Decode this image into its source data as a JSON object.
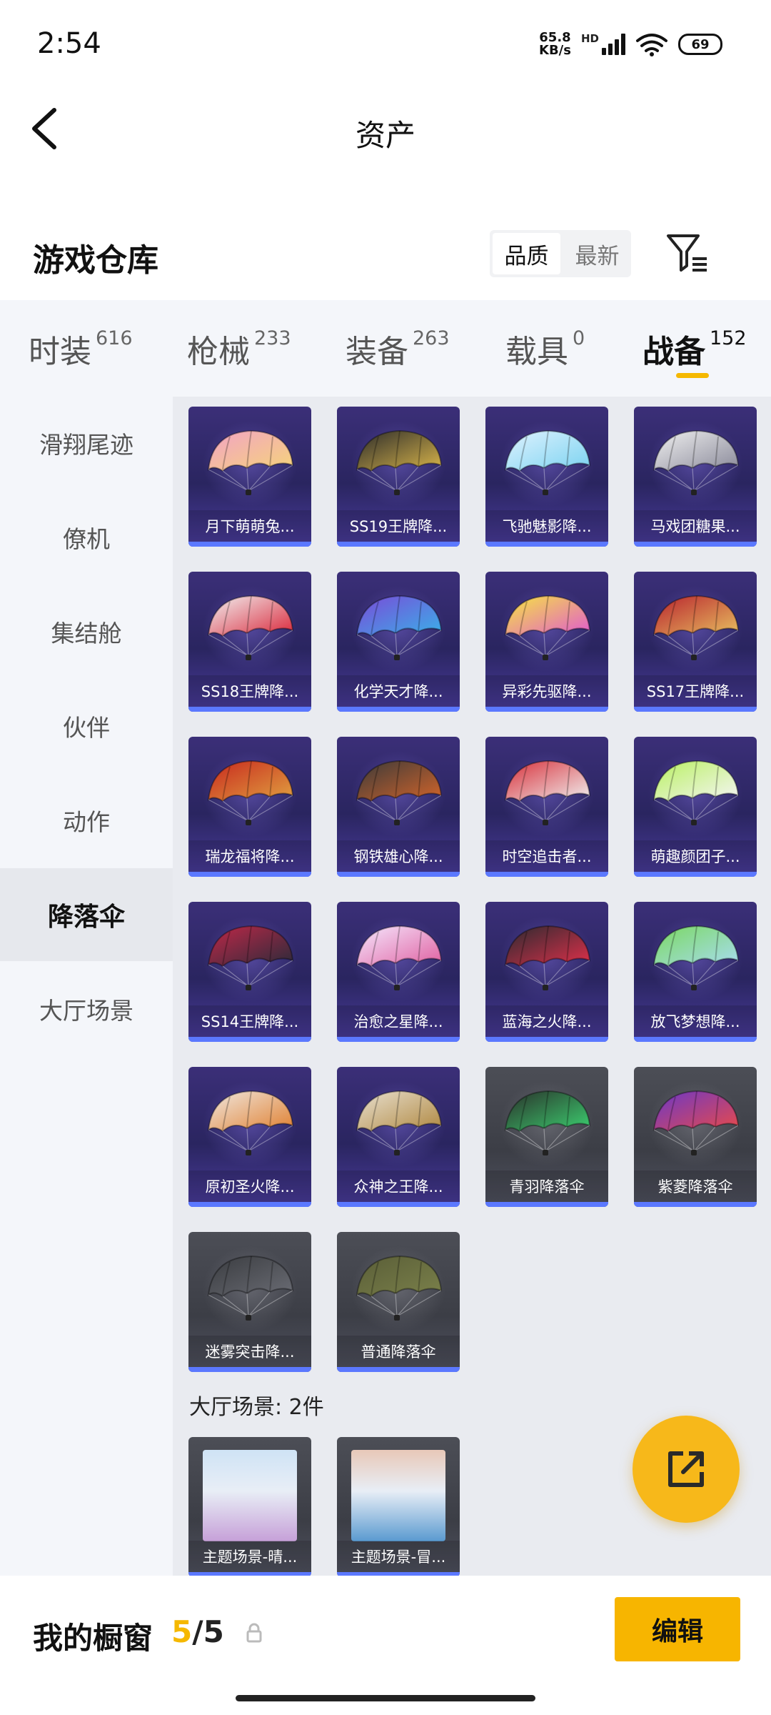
{
  "status": {
    "time": "2:54",
    "net_speed_value": "65.8",
    "net_speed_unit": "KB/s",
    "net_type": "HD",
    "wifi_index": "7",
    "battery": "69"
  },
  "header": {
    "title": "资产"
  },
  "warehouse": {
    "title": "游戏仓库",
    "sort_options": [
      "品质",
      "最新"
    ],
    "active_sort": "品质"
  },
  "categories": [
    {
      "label": "时装",
      "count": "616"
    },
    {
      "label": "枪械",
      "count": "233"
    },
    {
      "label": "装备",
      "count": "263"
    },
    {
      "label": "载具",
      "count": "0"
    },
    {
      "label": "战备",
      "count": "152"
    }
  ],
  "active_category": "战备",
  "sidebar": {
    "items": [
      "滑翔尾迹",
      "僚机",
      "集结舱",
      "伙伴",
      "动作",
      "降落伞",
      "大厅场景"
    ],
    "active": "降落伞"
  },
  "parachutes": [
    {
      "name": "月下萌萌兔...",
      "tier": "purple",
      "colors": [
        "#f2a3c6",
        "#f5d37a"
      ]
    },
    {
      "name": "SS19王牌降...",
      "tier": "purple",
      "colors": [
        "#2b2b2b",
        "#d9b54a"
      ]
    },
    {
      "name": "飞驰魅影降...",
      "tier": "purple",
      "colors": [
        "#dff2ff",
        "#7bd3f0"
      ]
    },
    {
      "name": "马戏团糖果...",
      "tier": "purple",
      "colors": [
        "#f0f0f0",
        "#8a8a9a"
      ]
    },
    {
      "name": "SS18王牌降...",
      "tier": "purple",
      "colors": [
        "#f2f2f2",
        "#d9273a"
      ]
    },
    {
      "name": "化学天才降...",
      "tier": "purple",
      "colors": [
        "#7a4ad8",
        "#3ab0e8"
      ]
    },
    {
      "name": "异彩先驱降...",
      "tier": "purple",
      "colors": [
        "#f6e640",
        "#e05ad0"
      ]
    },
    {
      "name": "SS17王牌降...",
      "tier": "purple",
      "colors": [
        "#b8222e",
        "#e8c060"
      ]
    },
    {
      "name": "瑞龙福将降...",
      "tier": "purple",
      "colors": [
        "#c8281e",
        "#e0a040"
      ]
    },
    {
      "name": "钢铁雄心降...",
      "tier": "purple",
      "colors": [
        "#3a3a3a",
        "#d2642a"
      ]
    },
    {
      "name": "时空追击者...",
      "tier": "purple",
      "colors": [
        "#d8303a",
        "#f0f0f0"
      ]
    },
    {
      "name": "萌趣颜团子...",
      "tier": "purple",
      "colors": [
        "#b8f060",
        "#f5f5f5"
      ]
    },
    {
      "name": "SS14王牌降...",
      "tier": "purple",
      "colors": [
        "#c02848",
        "#2a2a3a"
      ]
    },
    {
      "name": "治愈之星降...",
      "tier": "purple",
      "colors": [
        "#f5e8ff",
        "#e060a0"
      ]
    },
    {
      "name": "蓝海之火降...",
      "tier": "purple",
      "colors": [
        "#2a2a30",
        "#e0304a"
      ]
    },
    {
      "name": "放飞梦想降...",
      "tier": "purple",
      "colors": [
        "#7ad860",
        "#a8dcf0"
      ]
    },
    {
      "name": "原初圣火降...",
      "tier": "purple",
      "colors": [
        "#f0e8e0",
        "#e08030"
      ]
    },
    {
      "name": "众神之王降...",
      "tier": "purple",
      "colors": [
        "#e8e0d0",
        "#b08840"
      ]
    },
    {
      "name": "青羽降落伞",
      "tier": "gray",
      "colors": [
        "#2a2f2a",
        "#3cd070"
      ]
    },
    {
      "name": "紫菱降落伞",
      "tier": "gray",
      "colors": [
        "#6a38c8",
        "#e84a4a"
      ]
    },
    {
      "name": "迷雾突击降...",
      "tier": "gray",
      "colors": [
        "#3a3c40",
        "#6a6c74"
      ]
    },
    {
      "name": "普通降落伞",
      "tier": "gray",
      "colors": [
        "#5a5e38",
        "#7a804a"
      ]
    }
  ],
  "lobby_section": {
    "title": "大厅场景: 2件",
    "items": [
      {
        "name": "主题场景-晴...",
        "colors": [
          "#cfe3f5",
          "#c6a0d8"
        ]
      },
      {
        "name": "主题场景-冒...",
        "colors": [
          "#e8c8b8",
          "#5a9ad0"
        ]
      }
    ]
  },
  "bottom": {
    "showcase_label": "我的橱窗",
    "showcase_current": "5",
    "showcase_sep": "/",
    "showcase_max": "5",
    "edit_label": "编辑"
  },
  "accent_color": "#f5b800"
}
